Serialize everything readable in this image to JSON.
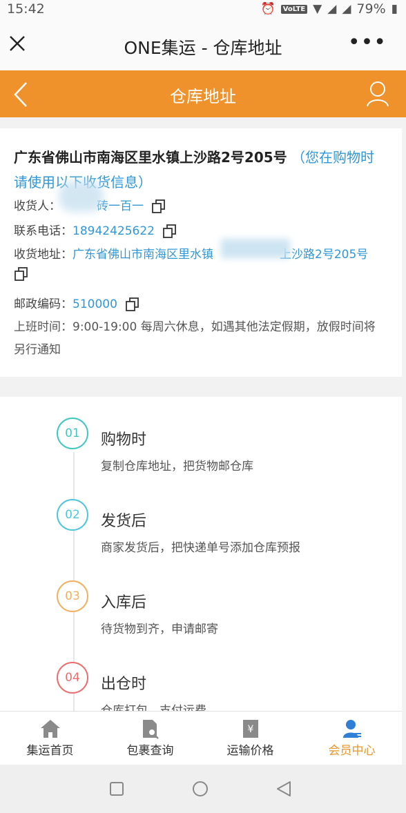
{
  "status_bar": {
    "time": "15:42",
    "volte": "VoLTE",
    "battery": "79%"
  },
  "webview": {
    "title": "ONE集运 - 仓库地址",
    "more": "•••"
  },
  "app_header": {
    "title": "仓库地址"
  },
  "address_card": {
    "title": "广东省佛山市南海区里水镇上沙路2号205号",
    "note": "（您在购物时请使用以下收货信息）",
    "recipient_label": "收货人：",
    "recipient_value": "砖一百一",
    "phone_label": "联系电话：",
    "phone_value": "18942425622",
    "address_label": "收货地址：",
    "address_value_start": "广东省佛山市南海区里水镇",
    "address_value_end": "上沙路2号205号",
    "postcode_label": "邮政编码：",
    "postcode_value": "510000",
    "hours_label": "上班时间：",
    "hours_value": "9:00-19:00 每周六休息，如遇其他法定假期，放假时间将另行通知"
  },
  "steps": [
    {
      "num": "01",
      "title": "购物时",
      "desc": "复制仓库地址，把货物邮仓库",
      "color": "#3cc7c1"
    },
    {
      "num": "02",
      "title": "发货后",
      "desc": "商家发货后，把快递单号添加仓库预报",
      "color": "#4cc6e0"
    },
    {
      "num": "03",
      "title": "入库后",
      "desc": "待货物到齐，申请邮寄",
      "color": "#f0b060"
    },
    {
      "num": "04",
      "title": "出仓时",
      "desc": "仓库打包，支付运费",
      "color": "#ec6d6d"
    }
  ],
  "bottom_nav": [
    {
      "label": "集运首页",
      "icon": "home-icon",
      "active": false
    },
    {
      "label": "包裹查询",
      "icon": "package-search-icon",
      "active": false
    },
    {
      "label": "运输价格",
      "icon": "price-icon",
      "active": false
    },
    {
      "label": "会员中心",
      "icon": "member-icon",
      "active": true
    }
  ],
  "colors": {
    "accent": "#f0922c",
    "link": "#2f97d6",
    "active_nav": "#e8962a"
  }
}
